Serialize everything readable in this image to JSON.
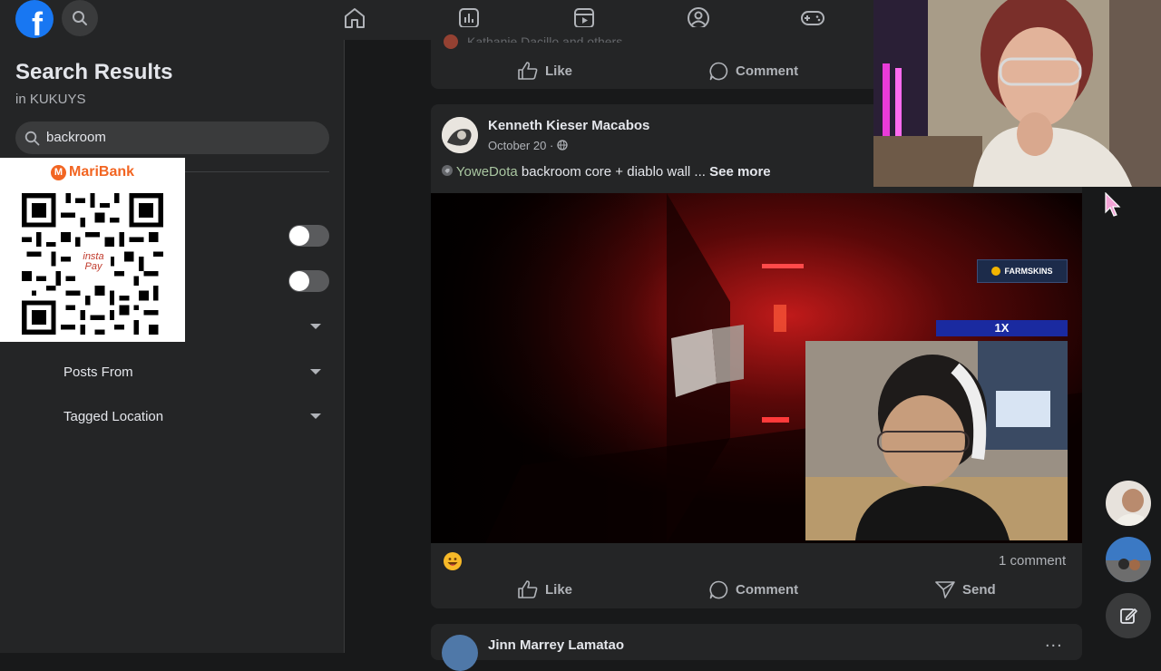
{
  "sidebar": {
    "title": "Search Results",
    "subtitle": "in KUKUYS",
    "search_value": "backroom",
    "filters": [
      {
        "label": "Posts From"
      },
      {
        "label": "Tagged Location"
      }
    ]
  },
  "qr_overlay": {
    "brand": "MariBank",
    "center_text": "insta Pay"
  },
  "top_post": {
    "reactors_text": "Kathanie Dacillo and others",
    "like_label": "Like",
    "comment_label": "Comment"
  },
  "post": {
    "author": "Kenneth Kieser Macabos",
    "date": "October 20",
    "tag": "YoweDota",
    "text": "backroom core + diablo wall ...",
    "see_more": "See more",
    "comment_count": "1 comment",
    "like_label": "Like",
    "comment_label": "Comment",
    "send_label": "Send",
    "video": {
      "sponsor_badge": "FARMSKINS",
      "sponsor_badge_2": "1X"
    }
  },
  "next_post": {
    "author": "Jinn Marrey Lamatao",
    "menu": "..."
  },
  "colors": {
    "brand_blue": "#1877f2",
    "panel": "#242526",
    "background": "#18191a",
    "text_primary": "#e4e6eb",
    "text_secondary": "#b0b3b8"
  }
}
